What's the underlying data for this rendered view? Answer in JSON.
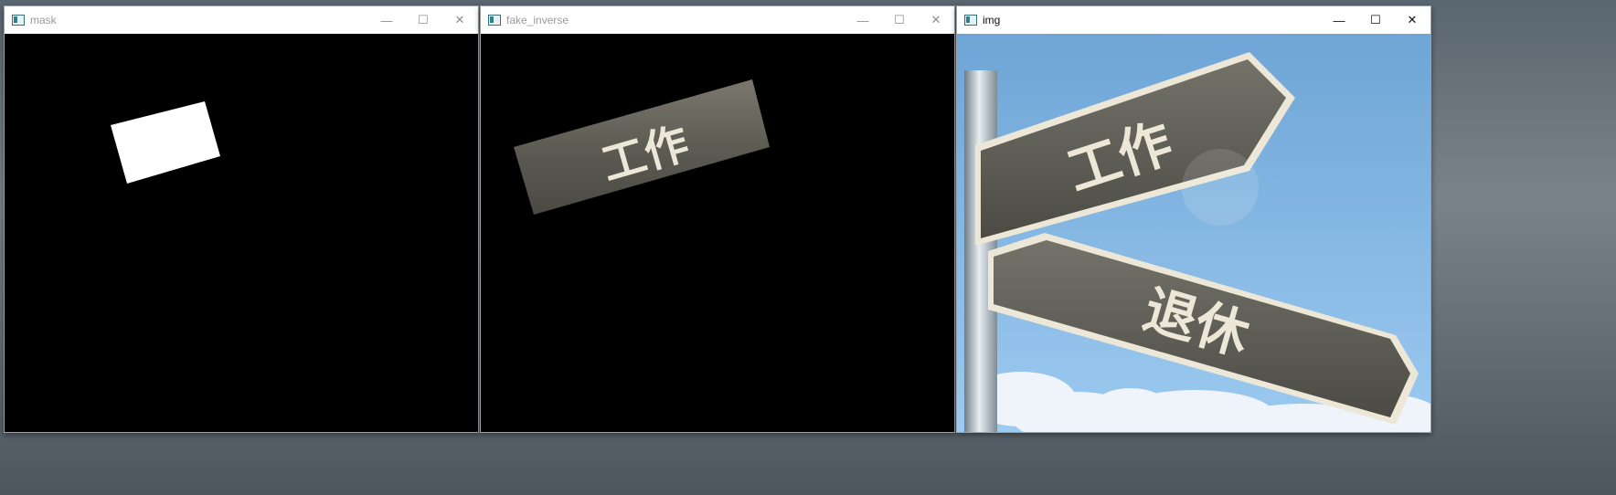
{
  "windows": [
    {
      "title": "mask",
      "state": "inactive"
    },
    {
      "title": "fake_inverse",
      "state": "inactive"
    },
    {
      "title": "img",
      "state": "active"
    }
  ],
  "controls": {
    "minimize": "—",
    "maximize": "☐",
    "close": "✕"
  },
  "signs": {
    "upper": "工作",
    "lower": "退休"
  },
  "colors": {
    "sign_wood": "#5b5a52",
    "sign_border": "#ece7d6",
    "sky_top": "#6ea5d6",
    "sky_bottom": "#9ccaf0"
  }
}
